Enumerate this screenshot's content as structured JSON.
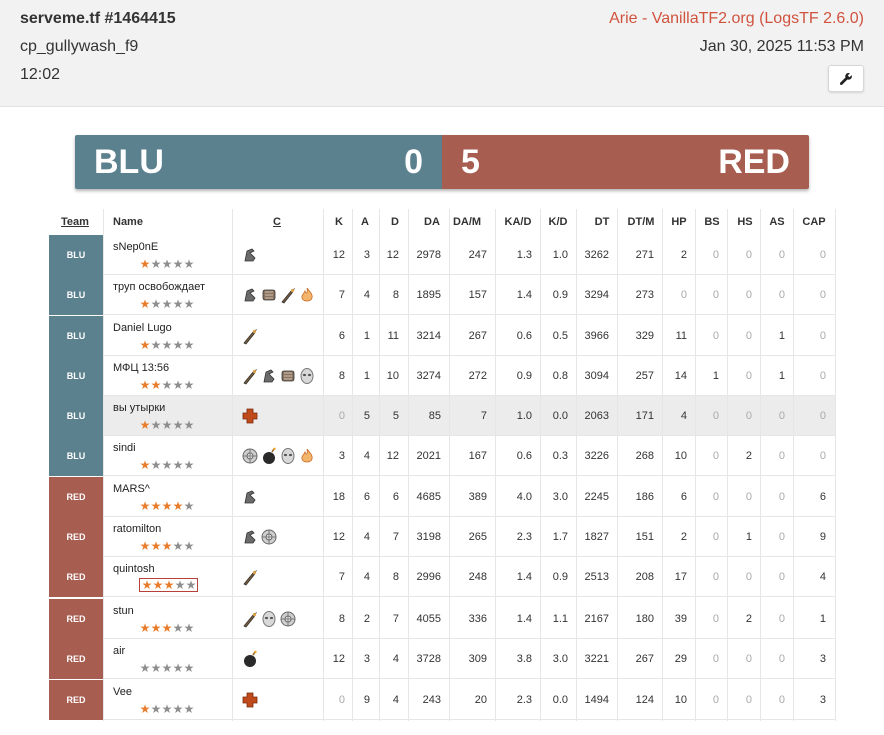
{
  "header": {
    "title": "serveme.tf #1464415",
    "map": "cp_gullywash_f9",
    "duration": "12:02",
    "uploader": "Arie - VanillaTF2.org (LogsTF 2.6.0)",
    "date": "Jan 30, 2025 11:53 PM",
    "tools_icon": "wrench-icon"
  },
  "score": {
    "blu_name": "BLU",
    "blu_score": "0",
    "red_score": "5",
    "red_name": "RED"
  },
  "colors": {
    "blu": "#5b818f",
    "red": "#a75d50",
    "accent": "#d0533e",
    "star_on": "#e87c2b",
    "star_off": "#8e8e8e"
  },
  "columns": [
    "Team",
    "Name",
    "C",
    "K",
    "A",
    "D",
    "DA",
    "DA/M",
    "KA/D",
    "K/D",
    "DT",
    "DT/M",
    "HP",
    "BS",
    "HS",
    "AS",
    "CAP"
  ],
  "players": [
    {
      "team": "BLU",
      "name": "sNep0nE",
      "stars": 1,
      "classes": [
        "scout"
      ],
      "K": "12",
      "A": "3",
      "D": "12",
      "DA": "2978",
      "DAM": "247",
      "KAD": "1.3",
      "KD": "1.0",
      "DT": "3262",
      "DTM": "271",
      "HP": "2",
      "BS": "0",
      "HS": "0",
      "AS": "0",
      "CAP": "0"
    },
    {
      "team": "BLU",
      "name": "труп освобождает",
      "stars": 1,
      "classes": [
        "scout",
        "heavy",
        "soldier",
        "pyro"
      ],
      "K": "7",
      "A": "4",
      "D": "8",
      "DA": "1895",
      "DAM": "157",
      "KAD": "1.4",
      "KD": "0.9",
      "DT": "3294",
      "DTM": "273",
      "HP": "0",
      "BS": "0",
      "HS": "0",
      "AS": "0",
      "CAP": "0"
    },
    {
      "team": "BLU",
      "name": "Daniel Lugo",
      "stars": 1,
      "classes": [
        "soldier"
      ],
      "K": "6",
      "A": "1",
      "D": "11",
      "DA": "3214",
      "DAM": "267",
      "KAD": "0.6",
      "KD": "0.5",
      "DT": "3966",
      "DTM": "329",
      "HP": "11",
      "BS": "0",
      "HS": "0",
      "AS": "1",
      "CAP": "0"
    },
    {
      "team": "BLU",
      "name": "МФЦ 13:56",
      "stars": 2,
      "classes": [
        "soldier",
        "scout",
        "heavy",
        "spy"
      ],
      "K": "8",
      "A": "1",
      "D": "10",
      "DA": "3274",
      "DAM": "272",
      "KAD": "0.9",
      "KD": "0.8",
      "DT": "3094",
      "DTM": "257",
      "HP": "14",
      "BS": "1",
      "HS": "0",
      "AS": "1",
      "CAP": "0"
    },
    {
      "team": "BLU",
      "name": "вы утырки",
      "stars": 1,
      "classes": [
        "medic"
      ],
      "K": "0",
      "A": "5",
      "D": "5",
      "DA": "85",
      "DAM": "7",
      "KAD": "1.0",
      "KD": "0.0",
      "DT": "2063",
      "DTM": "171",
      "HP": "4",
      "BS": "0",
      "HS": "0",
      "AS": "0",
      "CAP": "0",
      "highlight": true
    },
    {
      "team": "BLU",
      "name": "sindi",
      "stars": 1,
      "classes": [
        "engineer",
        "demoman",
        "spy",
        "pyro"
      ],
      "K": "3",
      "A": "4",
      "D": "12",
      "DA": "2021",
      "DAM": "167",
      "KAD": "0.6",
      "KD": "0.3",
      "DT": "3226",
      "DTM": "268",
      "HP": "10",
      "BS": "0",
      "HS": "2",
      "AS": "0",
      "CAP": "0"
    },
    {
      "team": "RED",
      "name": "MARS^",
      "stars": 4,
      "classes": [
        "scout"
      ],
      "K": "18",
      "A": "6",
      "D": "6",
      "DA": "4685",
      "DAM": "389",
      "KAD": "4.0",
      "KD": "3.0",
      "DT": "2245",
      "DTM": "186",
      "HP": "6",
      "BS": "0",
      "HS": "0",
      "AS": "0",
      "CAP": "6"
    },
    {
      "team": "RED",
      "name": "ratomilton",
      "stars": 3,
      "classes": [
        "scout",
        "engineer"
      ],
      "K": "12",
      "A": "4",
      "D": "7",
      "DA": "3198",
      "DAM": "265",
      "KAD": "2.3",
      "KD": "1.7",
      "DT": "1827",
      "DTM": "151",
      "HP": "2",
      "BS": "0",
      "HS": "1",
      "AS": "0",
      "CAP": "9"
    },
    {
      "team": "RED",
      "name": "quintosh",
      "stars": 3,
      "boxed": true,
      "classes": [
        "soldier"
      ],
      "K": "7",
      "A": "4",
      "D": "8",
      "DA": "2996",
      "DAM": "248",
      "KAD": "1.4",
      "KD": "0.9",
      "DT": "2513",
      "DTM": "208",
      "HP": "17",
      "BS": "0",
      "HS": "0",
      "AS": "0",
      "CAP": "4"
    },
    {
      "team": "RED",
      "name": "stun",
      "stars": 3,
      "classes": [
        "soldier",
        "spy",
        "engineer"
      ],
      "K": "8",
      "A": "2",
      "D": "7",
      "DA": "4055",
      "DAM": "336",
      "KAD": "1.4",
      "KD": "1.1",
      "DT": "2167",
      "DTM": "180",
      "HP": "39",
      "BS": "0",
      "HS": "2",
      "AS": "0",
      "CAP": "1"
    },
    {
      "team": "RED",
      "name": "air",
      "stars": 0,
      "classes": [
        "demoman"
      ],
      "K": "12",
      "A": "3",
      "D": "4",
      "DA": "3728",
      "DAM": "309",
      "KAD": "3.8",
      "KD": "3.0",
      "DT": "3221",
      "DTM": "267",
      "HP": "29",
      "BS": "0",
      "HS": "0",
      "AS": "0",
      "CAP": "3"
    },
    {
      "team": "RED",
      "name": "Vee",
      "stars": 1,
      "classes": [
        "medic"
      ],
      "K": "0",
      "A": "9",
      "D": "4",
      "DA": "243",
      "DAM": "20",
      "KAD": "2.3",
      "KD": "0.0",
      "DT": "1494",
      "DTM": "124",
      "HP": "10",
      "BS": "0",
      "HS": "0",
      "AS": "0",
      "CAP": "3"
    }
  ]
}
